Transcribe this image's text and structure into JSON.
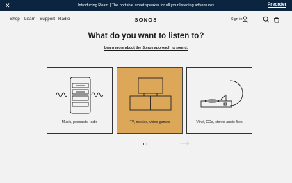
{
  "promo": {
    "close": "✕",
    "message": "Introducing Roam | The portable smart speaker for all your listening adventures",
    "cta": "Preorder"
  },
  "nav": {
    "left": [
      "Shop",
      "Learn",
      "Support",
      "Radio"
    ],
    "logo": "SONOS",
    "signin": "Sign in"
  },
  "main": {
    "title": "What do you want to listen to?",
    "learn_link": "Learn more about the Sonos approach to sound."
  },
  "cards": [
    {
      "label": "Music, podcasts, radio",
      "selected": false
    },
    {
      "label": "TV, movies, video games",
      "selected": true
    },
    {
      "label": "Vinyl, CDs, stored audio files",
      "selected": false
    }
  ],
  "carousel": {
    "current_page": 1,
    "pages": 2
  },
  "colors": {
    "promo_bg": "#0b2540",
    "selected_card": "#dda75a",
    "page_bg": "#f2f2f2"
  },
  "icons": [
    "close-icon",
    "user-icon",
    "search-icon",
    "bag-icon",
    "arrow-right-icon"
  ]
}
